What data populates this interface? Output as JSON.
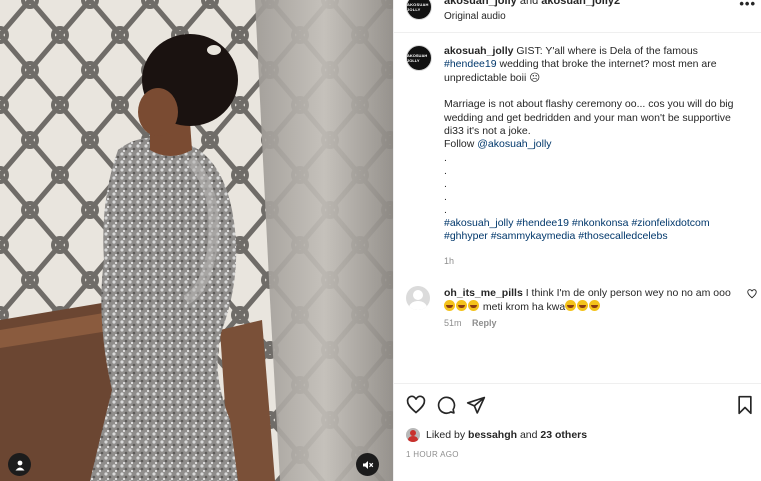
{
  "header": {
    "username_1": "akosuah_jolly",
    "joiner": "and",
    "username_2": "akosuah_jolly2",
    "audio": "Original audio",
    "avatar_text": "AKOSUAH JOLLY"
  },
  "caption": {
    "username": "akosuah_jolly",
    "text_part1": "GIST: Y'all where is Dela of the famous",
    "hashtag_1": "#hendee19",
    "text_part2": "wedding that broke the internet? most men are unpredictable boii ☹",
    "paragraph2": "Marriage is not about flashy ceremony oo... cos you will do big wedding and get bedridden and your man won't be supportive di33 it's not a joke.",
    "follow_label": "Follow",
    "follow_handle": "@akosuah_jolly",
    "dots": [
      ".",
      ".",
      ".",
      ".",
      "."
    ],
    "hashtags_line1": [
      "#akosuah_jolly",
      "#hendee19",
      "#nkonkonsa",
      "#zionfelixdotcom"
    ],
    "hashtags_line2": [
      "#ghhyper",
      "#sammykaymedia",
      "#thosecalledcelebs"
    ],
    "time": "1h"
  },
  "comment": {
    "username": "oh_its_me_pills",
    "text_part1": "I think I'm de only person wey no no am ooo",
    "text_part2": "meti krom ha kwa",
    "time": "51m",
    "reply_label": "Reply"
  },
  "likes": {
    "prefix": "Liked by",
    "user": "bessahgh",
    "joiner": "and",
    "others": "23 others"
  },
  "post_date": "1 HOUR AGO",
  "icons": {
    "like": "heart-icon",
    "comment": "comment-icon",
    "share": "send-icon",
    "save": "bookmark-icon",
    "more": "more-icon",
    "mute": "muted-speaker-icon",
    "tagged": "user-icon"
  },
  "colors": {
    "link": "#00376b",
    "muted": "#8e8e8e",
    "border": "#efefef",
    "text": "#262626"
  }
}
